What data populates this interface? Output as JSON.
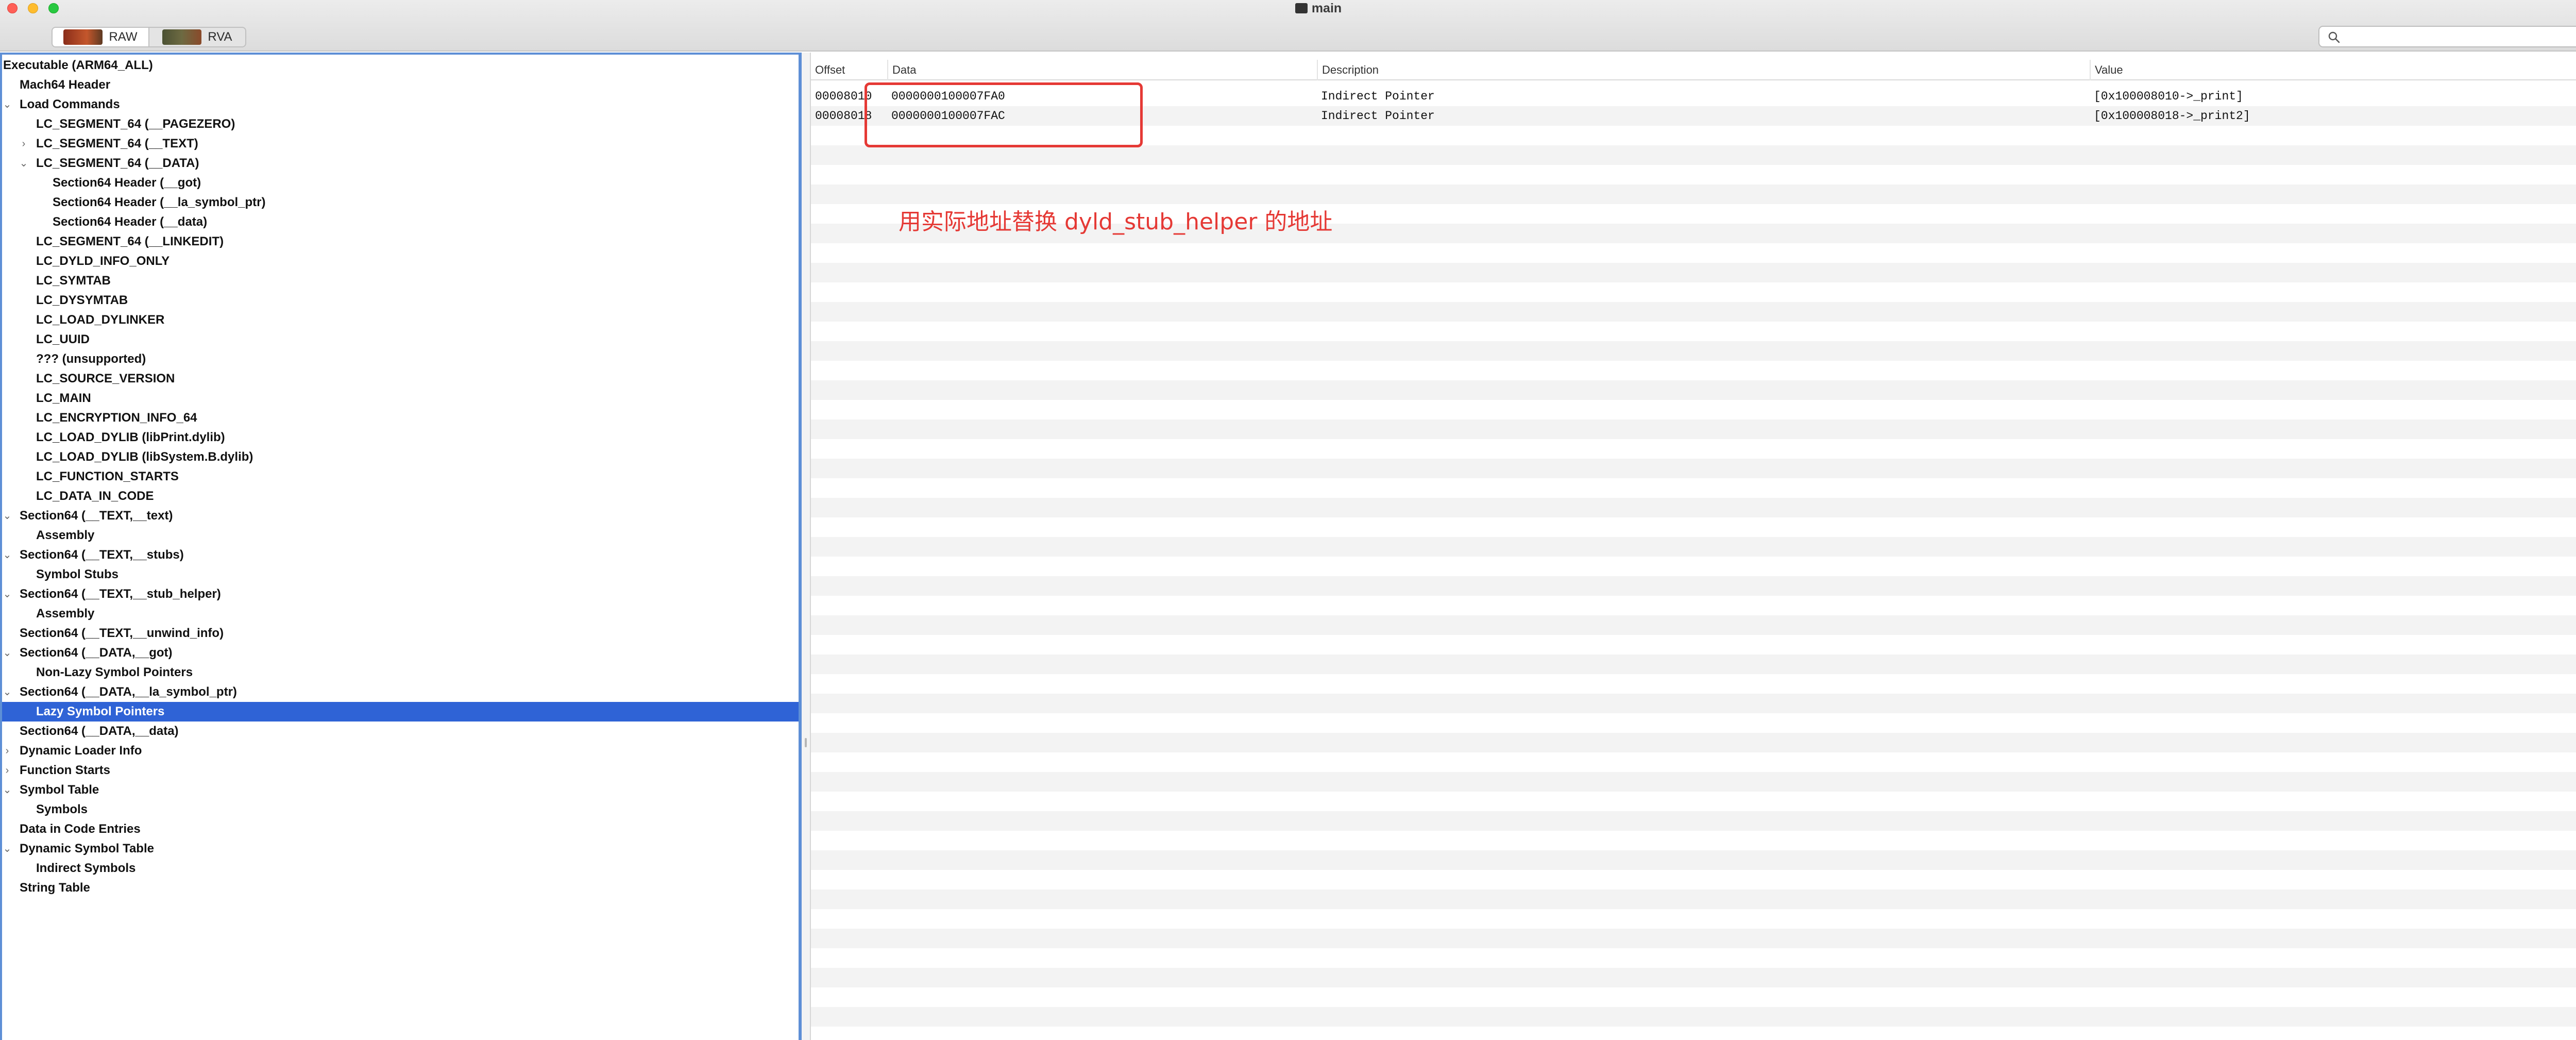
{
  "window": {
    "title": "main"
  },
  "toolbar": {
    "segments": [
      {
        "label": "RAW",
        "icon": "raw-thumbnail-icon",
        "active": true
      },
      {
        "label": "RVA",
        "icon": "rva-thumbnail-icon",
        "active": false
      }
    ],
    "search": {
      "placeholder": "",
      "value": ""
    }
  },
  "outline": {
    "items": [
      {
        "label": "Executable  (ARM64_ALL)",
        "level": 0,
        "disclosure": ""
      },
      {
        "label": "Mach64 Header",
        "level": 1,
        "disclosure": ""
      },
      {
        "label": "Load Commands",
        "level": 1,
        "disclosure": "expanded"
      },
      {
        "label": "LC_SEGMENT_64 (__PAGEZERO)",
        "level": 2,
        "disclosure": ""
      },
      {
        "label": "LC_SEGMENT_64 (__TEXT)",
        "level": 2,
        "disclosure": "collapsed"
      },
      {
        "label": "LC_SEGMENT_64 (__DATA)",
        "level": 2,
        "disclosure": "expanded"
      },
      {
        "label": "Section64 Header (__got)",
        "level": 3,
        "disclosure": ""
      },
      {
        "label": "Section64 Header (__la_symbol_ptr)",
        "level": 3,
        "disclosure": ""
      },
      {
        "label": "Section64 Header (__data)",
        "level": 3,
        "disclosure": ""
      },
      {
        "label": "LC_SEGMENT_64 (__LINKEDIT)",
        "level": 2,
        "disclosure": ""
      },
      {
        "label": "LC_DYLD_INFO_ONLY",
        "level": 2,
        "disclosure": ""
      },
      {
        "label": "LC_SYMTAB",
        "level": 2,
        "disclosure": ""
      },
      {
        "label": "LC_DYSYMTAB",
        "level": 2,
        "disclosure": ""
      },
      {
        "label": "LC_LOAD_DYLINKER",
        "level": 2,
        "disclosure": ""
      },
      {
        "label": "LC_UUID",
        "level": 2,
        "disclosure": ""
      },
      {
        "label": "??? (unsupported)",
        "level": 2,
        "disclosure": ""
      },
      {
        "label": "LC_SOURCE_VERSION",
        "level": 2,
        "disclosure": ""
      },
      {
        "label": "LC_MAIN",
        "level": 2,
        "disclosure": ""
      },
      {
        "label": "LC_ENCRYPTION_INFO_64",
        "level": 2,
        "disclosure": ""
      },
      {
        "label": "LC_LOAD_DYLIB (libPrint.dylib)",
        "level": 2,
        "disclosure": ""
      },
      {
        "label": "LC_LOAD_DYLIB (libSystem.B.dylib)",
        "level": 2,
        "disclosure": ""
      },
      {
        "label": "LC_FUNCTION_STARTS",
        "level": 2,
        "disclosure": ""
      },
      {
        "label": "LC_DATA_IN_CODE",
        "level": 2,
        "disclosure": ""
      },
      {
        "label": "Section64 (__TEXT,__text)",
        "level": 1,
        "disclosure": "expanded"
      },
      {
        "label": "Assembly",
        "level": 2,
        "disclosure": ""
      },
      {
        "label": "Section64 (__TEXT,__stubs)",
        "level": 1,
        "disclosure": "expanded"
      },
      {
        "label": "Symbol Stubs",
        "level": 2,
        "disclosure": ""
      },
      {
        "label": "Section64 (__TEXT,__stub_helper)",
        "level": 1,
        "disclosure": "expanded"
      },
      {
        "label": "Assembly",
        "level": 2,
        "disclosure": ""
      },
      {
        "label": "Section64 (__TEXT,__unwind_info)",
        "level": 1,
        "disclosure": ""
      },
      {
        "label": "Section64 (__DATA,__got)",
        "level": 1,
        "disclosure": "expanded"
      },
      {
        "label": "Non-Lazy Symbol Pointers",
        "level": 2,
        "disclosure": ""
      },
      {
        "label": "Section64 (__DATA,__la_symbol_ptr)",
        "level": 1,
        "disclosure": "expanded"
      },
      {
        "label": "Lazy Symbol Pointers",
        "level": 2,
        "disclosure": "",
        "selected": true
      },
      {
        "label": "Section64 (__DATA,__data)",
        "level": 1,
        "disclosure": ""
      },
      {
        "label": "Dynamic Loader Info",
        "level": 1,
        "disclosure": "collapsed"
      },
      {
        "label": "Function Starts",
        "level": 1,
        "disclosure": "collapsed"
      },
      {
        "label": "Symbol Table",
        "level": 1,
        "disclosure": "expanded"
      },
      {
        "label": "Symbols",
        "level": 2,
        "disclosure": ""
      },
      {
        "label": "Data in Code Entries",
        "level": 1,
        "disclosure": ""
      },
      {
        "label": "Dynamic Symbol Table",
        "level": 1,
        "disclosure": "expanded"
      },
      {
        "label": "Indirect Symbols",
        "level": 2,
        "disclosure": ""
      },
      {
        "label": "String Table",
        "level": 1,
        "disclosure": ""
      }
    ]
  },
  "table": {
    "columns": [
      "Offset",
      "Data",
      "Description",
      "Value"
    ],
    "rows": [
      [
        "00008010",
        "0000000100007FA0",
        "Indirect Pointer",
        "[0x100008010->_print]"
      ],
      [
        "00008018",
        "0000000100007FAC",
        "Indirect Pointer",
        "[0x100008018->_print2]"
      ]
    ]
  },
  "annotation": {
    "text": "用实际地址替换 dyld_stub_helper 的地址",
    "color": "#e53935"
  },
  "colors": {
    "selection": "#2f63d6",
    "focus_ring": "#5e8fd6",
    "row_alt": "#f3f3f3"
  }
}
